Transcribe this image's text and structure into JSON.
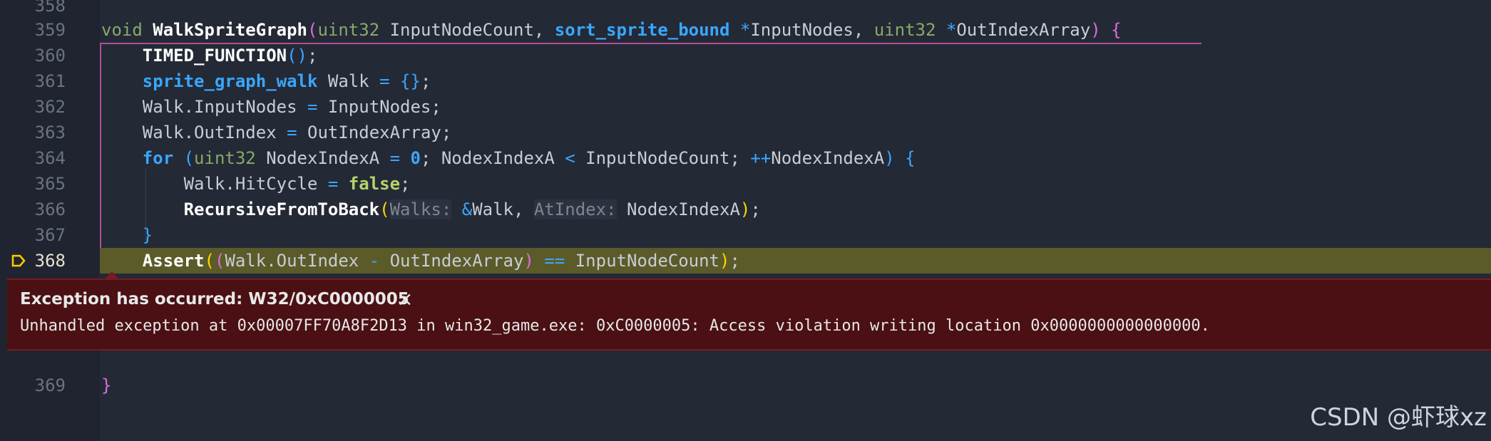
{
  "editor": {
    "lines": [
      {
        "num": "358",
        "text": ""
      },
      {
        "num": "359",
        "tokens": [
          {
            "t": "void ",
            "c": "typ"
          },
          {
            "t": "WalkSpriteGraph",
            "c": "fn"
          },
          {
            "t": "(",
            "c": "brace-p"
          },
          {
            "t": "uint32 ",
            "c": "typ"
          },
          {
            "t": "InputNodeCount, ",
            "c": ""
          },
          {
            "t": "sort_sprite_bound ",
            "c": "kw"
          },
          {
            "t": "*",
            "c": "op"
          },
          {
            "t": "InputNodes, ",
            "c": ""
          },
          {
            "t": "uint32 ",
            "c": "typ"
          },
          {
            "t": "*",
            "c": "op"
          },
          {
            "t": "OutIndexArray",
            "c": ""
          },
          {
            "t": ") {",
            "c": "brace-p"
          }
        ]
      },
      {
        "num": "360",
        "tokens": [
          {
            "t": "    TIMED_FUNCTION",
            "c": "fn"
          },
          {
            "t": "()",
            "c": "brace-b"
          },
          {
            "t": ";",
            "c": ""
          }
        ]
      },
      {
        "num": "361",
        "tokens": [
          {
            "t": "    sprite_graph_walk ",
            "c": "kw"
          },
          {
            "t": "Walk ",
            "c": ""
          },
          {
            "t": "= ",
            "c": "op"
          },
          {
            "t": "{}",
            "c": "brace-b"
          },
          {
            "t": ";",
            "c": ""
          }
        ]
      },
      {
        "num": "362",
        "tokens": [
          {
            "t": "    Walk.InputNodes ",
            "c": ""
          },
          {
            "t": "= ",
            "c": "op"
          },
          {
            "t": "InputNodes;",
            "c": ""
          }
        ]
      },
      {
        "num": "363",
        "tokens": [
          {
            "t": "    Walk.OutIndex ",
            "c": ""
          },
          {
            "t": "= ",
            "c": "op"
          },
          {
            "t": "OutIndexArray;",
            "c": ""
          }
        ]
      },
      {
        "num": "364",
        "tokens": [
          {
            "t": "    for ",
            "c": "kw"
          },
          {
            "t": "(",
            "c": "brace-b"
          },
          {
            "t": "uint32 ",
            "c": "typ"
          },
          {
            "t": "NodexIndexA ",
            "c": ""
          },
          {
            "t": "= ",
            "c": "op"
          },
          {
            "t": "0",
            "c": "num"
          },
          {
            "t": "; NodexIndexA ",
            "c": ""
          },
          {
            "t": "< ",
            "c": "op"
          },
          {
            "t": "InputNodeCount; ",
            "c": ""
          },
          {
            "t": "++",
            "c": "op"
          },
          {
            "t": "NodexIndexA",
            "c": ""
          },
          {
            "t": ") {",
            "c": "brace-b"
          }
        ]
      },
      {
        "num": "365",
        "tokens": [
          {
            "t": "        Walk.HitCycle ",
            "c": ""
          },
          {
            "t": "= ",
            "c": "op"
          },
          {
            "t": "false",
            "c": "bool"
          },
          {
            "t": ";",
            "c": ""
          }
        ]
      },
      {
        "num": "366",
        "tokens": [
          {
            "t": "        RecursiveFromToBack",
            "c": "fn"
          },
          {
            "t": "(",
            "c": "brace-y"
          },
          {
            "t": "Walks:",
            "c": "hint"
          },
          {
            "t": " ",
            "c": ""
          },
          {
            "t": "&",
            "c": "op"
          },
          {
            "t": "Walk, ",
            "c": ""
          },
          {
            "t": "AtIndex:",
            "c": "hint"
          },
          {
            "t": " NodexIndexA",
            "c": ""
          },
          {
            "t": ")",
            "c": "brace-y"
          },
          {
            "t": ";",
            "c": ""
          }
        ]
      },
      {
        "num": "367",
        "tokens": [
          {
            "t": "    }",
            "c": "brace-b"
          }
        ]
      },
      {
        "num": "368",
        "tokens": [
          {
            "t": "    Assert",
            "c": "fn"
          },
          {
            "t": "(",
            "c": "brace-y"
          },
          {
            "t": "(",
            "c": "brace-p"
          },
          {
            "t": "Walk.OutIndex ",
            "c": ""
          },
          {
            "t": "- ",
            "c": "op"
          },
          {
            "t": "OutIndexArray",
            "c": ""
          },
          {
            "t": ") ",
            "c": "brace-p"
          },
          {
            "t": "== ",
            "c": "op"
          },
          {
            "t": "InputNodeCount",
            "c": ""
          },
          {
            "t": ")",
            "c": "brace-y"
          },
          {
            "t": ";",
            "c": ""
          }
        ]
      },
      {
        "num": "369",
        "tokens": [
          {
            "t": "}",
            "c": "brace-p"
          }
        ]
      }
    ]
  },
  "exception": {
    "title": "Exception has occurred: W32/0xC0000005",
    "close_icon": "×",
    "message": "Unhandled exception at 0x00007FF70A8F2D13 in win32_game.exe: 0xC0000005: Access violation writing location 0x0000000000000000."
  },
  "watermark": "CSDN @虾球xz",
  "colors": {
    "highlight_line": "#5b5b2a",
    "exception_bg": "#4a1014",
    "scope_border": "#b04f94"
  }
}
